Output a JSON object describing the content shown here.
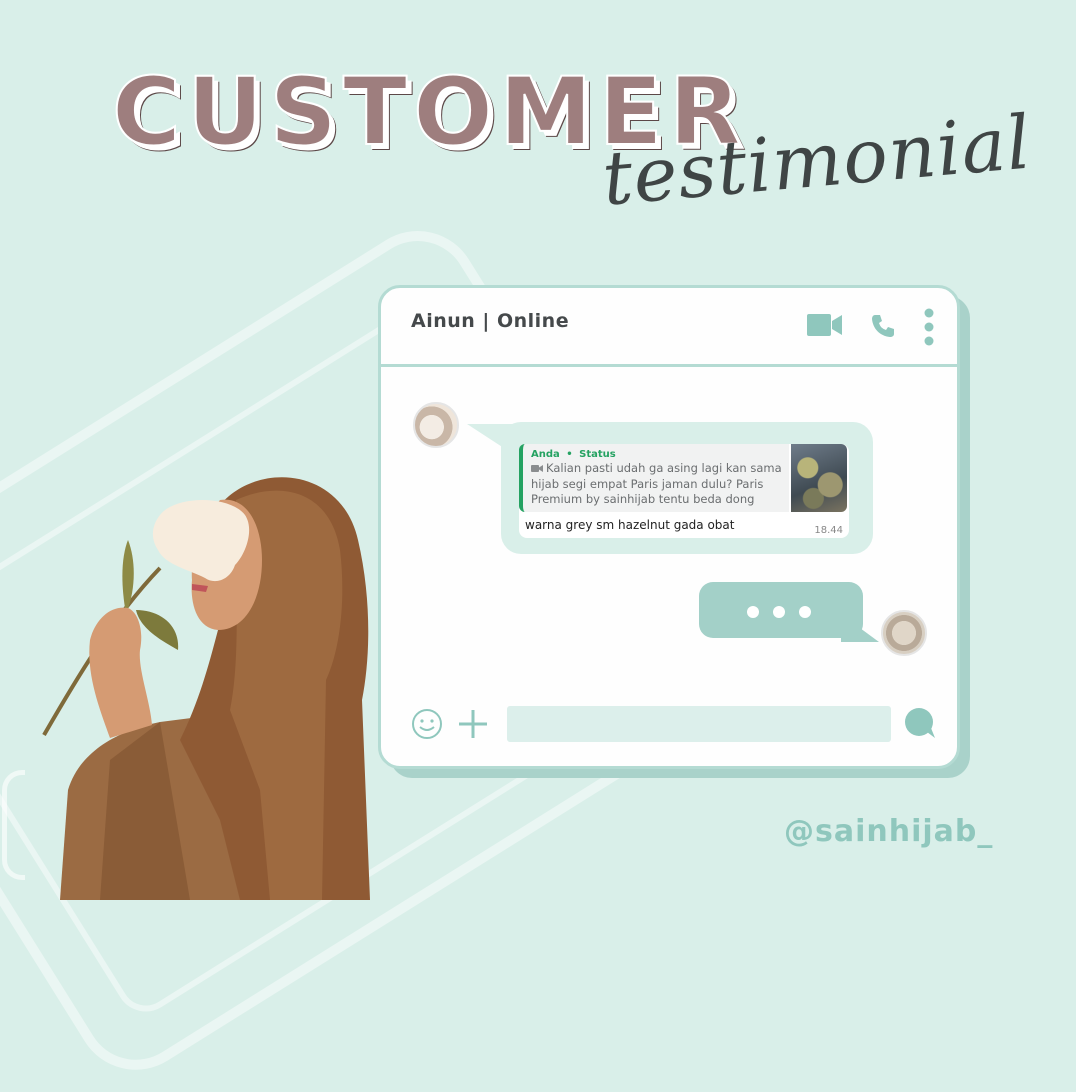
{
  "header": {
    "title": "CUSTOMER",
    "subtitle": "testimonial"
  },
  "chat": {
    "contact_title": "Ainun | Online",
    "icons": [
      "video-call-icon",
      "phone-icon",
      "more-vertical-icon",
      "emoji-icon",
      "plus-icon",
      "send-icon"
    ],
    "incoming_message": {
      "quote_sender": "Anda",
      "quote_separator": "•",
      "quote_label": "Status",
      "quote_text": "Kalian pasti udah ga asing lagi kan sama hijab segi empat Paris jaman dulu? Paris Premium by sainhijab tentu beda dong den...",
      "reply_text": "warna grey sm hazelnut gada obat",
      "time": "18.44"
    },
    "outgoing_message": {
      "typing_indicator": "typing-dots"
    },
    "input_value": ""
  },
  "footer": {
    "handle": "@sainhijab_"
  },
  "colors": {
    "background": "#d9efe9",
    "title": "#9e7e7e",
    "accent": "#a3d0c8",
    "status_green": "#25a262",
    "handle": "#8fc7bd"
  }
}
